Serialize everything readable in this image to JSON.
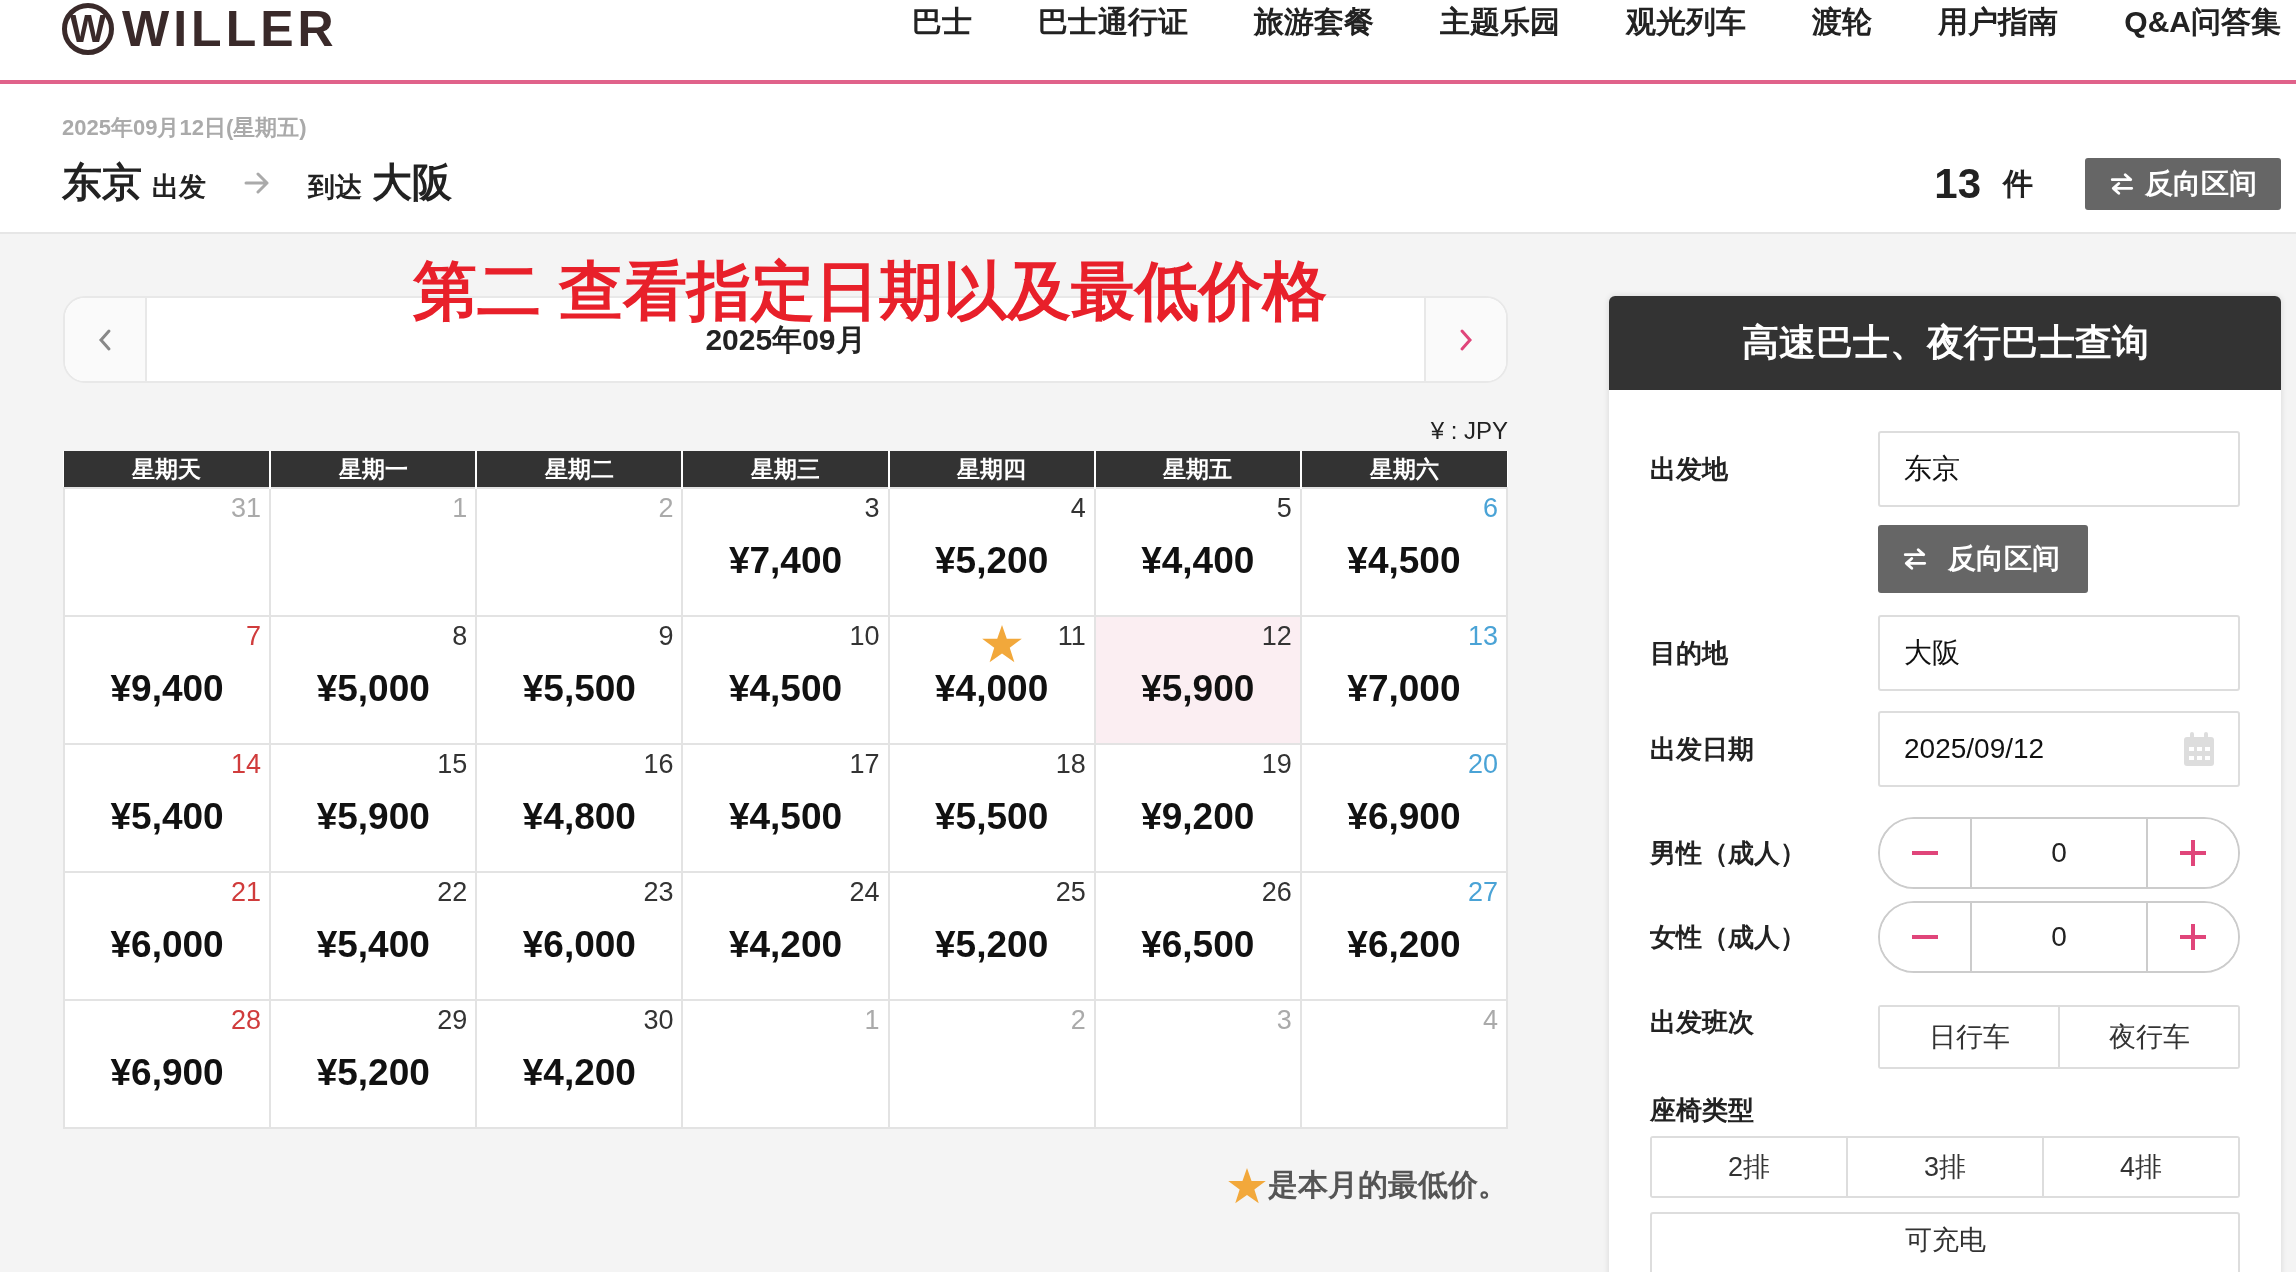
{
  "header": {
    "logo": {
      "mark": "W",
      "name": "WILLER"
    },
    "nav": [
      "巴士",
      "巴士通行证",
      "旅游套餐",
      "主题乐园",
      "观光列车",
      "渡轮",
      "用户指南",
      "Q&A问答集"
    ]
  },
  "route": {
    "date": "2025年09月12日(星期五)",
    "from": "东京",
    "from_suffix": "出发",
    "to_prefix": "到达",
    "to": "大阪",
    "count": "13",
    "count_unit": "件",
    "reverse_button": "反向区间"
  },
  "annotation": "第二 查看指定日期以及最低价格",
  "calendar": {
    "month": "2025年09月",
    "currency": "¥ : JPY",
    "weekdays": [
      "星期天",
      "星期一",
      "星期二",
      "星期三",
      "星期四",
      "星期五",
      "星期六"
    ],
    "weeks": [
      [
        {
          "day": "31",
          "in_month": false,
          "selected": false,
          "lowest": false
        },
        {
          "day": "1",
          "in_month": false,
          "selected": false,
          "lowest": false
        },
        {
          "day": "2",
          "in_month": false,
          "selected": false,
          "lowest": false
        },
        {
          "day": "3",
          "price": "¥7,400",
          "in_month": true,
          "selected": false,
          "lowest": false
        },
        {
          "day": "4",
          "price": "¥5,200",
          "in_month": true,
          "selected": false,
          "lowest": false
        },
        {
          "day": "5",
          "price": "¥4,400",
          "in_month": true,
          "selected": false,
          "lowest": false
        },
        {
          "day": "6",
          "price": "¥4,500",
          "in_month": true,
          "selected": false,
          "lowest": false
        }
      ],
      [
        {
          "day": "7",
          "price": "¥9,400",
          "in_month": true,
          "selected": false,
          "lowest": false
        },
        {
          "day": "8",
          "price": "¥5,000",
          "in_month": true,
          "selected": false,
          "lowest": false
        },
        {
          "day": "9",
          "price": "¥5,500",
          "in_month": true,
          "selected": false,
          "lowest": false
        },
        {
          "day": "10",
          "price": "¥4,500",
          "in_month": true,
          "selected": false,
          "lowest": false
        },
        {
          "day": "11",
          "price": "¥4,000",
          "in_month": true,
          "selected": false,
          "lowest": true
        },
        {
          "day": "12",
          "price": "¥5,900",
          "in_month": true,
          "selected": true,
          "lowest": false
        },
        {
          "day": "13",
          "price": "¥7,000",
          "in_month": true,
          "selected": false,
          "lowest": false
        }
      ],
      [
        {
          "day": "14",
          "price": "¥5,400",
          "in_month": true,
          "selected": false,
          "lowest": false
        },
        {
          "day": "15",
          "price": "¥5,900",
          "in_month": true,
          "selected": false,
          "lowest": false
        },
        {
          "day": "16",
          "price": "¥4,800",
          "in_month": true,
          "selected": false,
          "lowest": false
        },
        {
          "day": "17",
          "price": "¥4,500",
          "in_month": true,
          "selected": false,
          "lowest": false
        },
        {
          "day": "18",
          "price": "¥5,500",
          "in_month": true,
          "selected": false,
          "lowest": false
        },
        {
          "day": "19",
          "price": "¥9,200",
          "in_month": true,
          "selected": false,
          "lowest": false
        },
        {
          "day": "20",
          "price": "¥6,900",
          "in_month": true,
          "selected": false,
          "lowest": false
        }
      ],
      [
        {
          "day": "21",
          "price": "¥6,000",
          "in_month": true,
          "selected": false,
          "lowest": false
        },
        {
          "day": "22",
          "price": "¥5,400",
          "in_month": true,
          "selected": false,
          "lowest": false
        },
        {
          "day": "23",
          "price": "¥6,000",
          "in_month": true,
          "selected": false,
          "lowest": false
        },
        {
          "day": "24",
          "price": "¥4,200",
          "in_month": true,
          "selected": false,
          "lowest": false
        },
        {
          "day": "25",
          "price": "¥5,200",
          "in_month": true,
          "selected": false,
          "lowest": false
        },
        {
          "day": "26",
          "price": "¥6,500",
          "in_month": true,
          "selected": false,
          "lowest": false
        },
        {
          "day": "27",
          "price": "¥6,200",
          "in_month": true,
          "selected": false,
          "lowest": false
        }
      ],
      [
        {
          "day": "28",
          "price": "¥6,900",
          "in_month": true,
          "selected": false,
          "lowest": false
        },
        {
          "day": "29",
          "price": "¥5,200",
          "in_month": true,
          "selected": false,
          "lowest": false
        },
        {
          "day": "30",
          "price": "¥4,200",
          "in_month": true,
          "selected": false,
          "lowest": false
        },
        {
          "day": "1",
          "in_month": false,
          "selected": false,
          "lowest": false
        },
        {
          "day": "2",
          "in_month": false,
          "selected": false,
          "lowest": false
        },
        {
          "day": "3",
          "in_month": false,
          "selected": false,
          "lowest": false
        },
        {
          "day": "4",
          "in_month": false,
          "selected": false,
          "lowest": false
        }
      ]
    ]
  },
  "legend": "是本月的最低价。",
  "panel": {
    "title": "高速巴士、夜行巴士查询",
    "rows": [
      {
        "kind": "input",
        "label": "出发地",
        "value": "东京"
      },
      {
        "kind": "swap",
        "button": "反向区间"
      },
      {
        "kind": "input",
        "label": "目的地",
        "value": "大阪"
      },
      {
        "kind": "date",
        "label": "出发日期",
        "value": "2025/09/12"
      },
      {
        "kind": "stepper",
        "label": "男性（成人）",
        "value": "0"
      },
      {
        "kind": "stepper",
        "label": "女性（成人）",
        "value": "0"
      },
      {
        "kind": "choice",
        "label": "出发班次",
        "options": [
          {
            "label": "日行车",
            "selected": false
          },
          {
            "label": "夜行车",
            "selected": false
          }
        ]
      },
      {
        "kind": "block",
        "label": "座椅类型",
        "options": [
          {
            "label": "2排",
            "selected": false
          },
          {
            "label": "3排",
            "selected": false
          },
          {
            "label": "4排",
            "selected": false
          }
        ]
      },
      {
        "kind": "toggle",
        "label": "可充电",
        "selected": false
      }
    ]
  }
}
